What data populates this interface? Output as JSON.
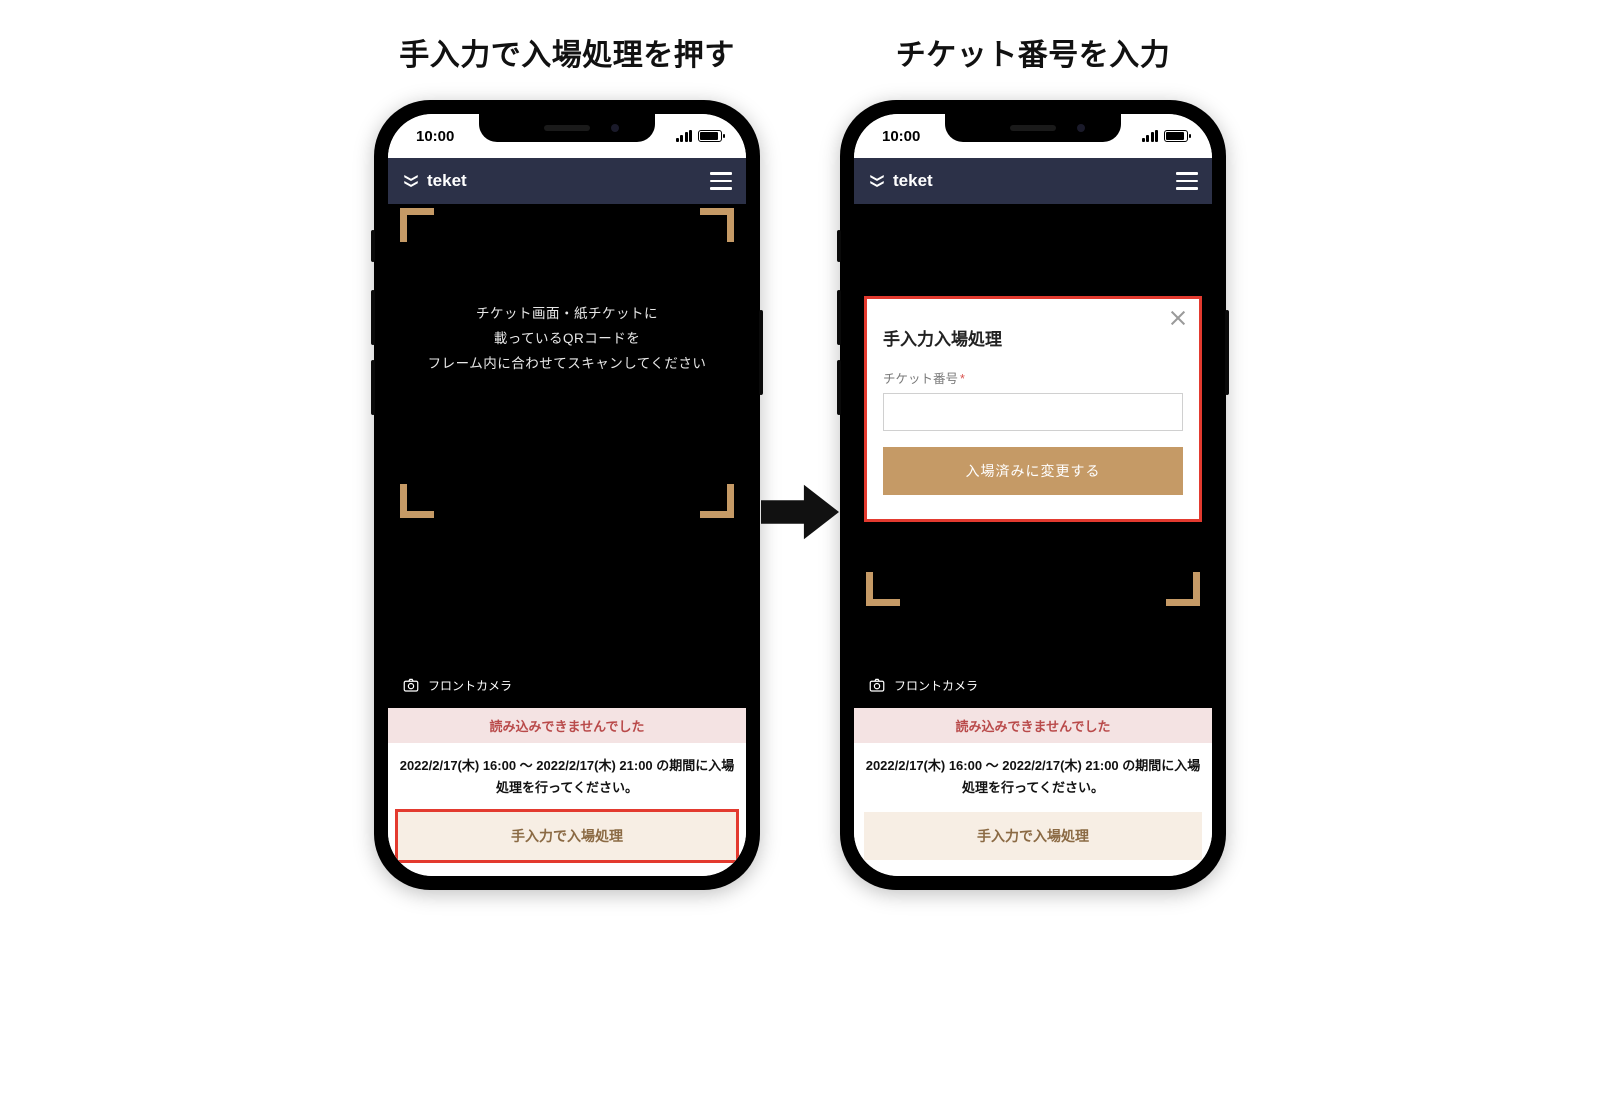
{
  "headings": {
    "left": "手入力で入場処理を押す",
    "right": "チケット番号を入力"
  },
  "status": {
    "time": "10:00"
  },
  "header": {
    "brand": "teket"
  },
  "scan": {
    "line1": "チケット画面・紙チケットに",
    "line2": "載っているQRコードを",
    "line3": "フレーム内に合わせてスキャンしてください",
    "front_camera": "フロントカメラ"
  },
  "bottom": {
    "error": "読み込みできませんでした",
    "period": "2022/2/17(木) 16:00 〜 2022/2/17(木) 21:00 の期間に入場処理を行ってください。",
    "manual_button": "手入力で入場処理"
  },
  "modal": {
    "title": "手入力入場処理",
    "field_label": "チケット番号",
    "required_mark": "*",
    "submit": "入場済みに変更する"
  }
}
